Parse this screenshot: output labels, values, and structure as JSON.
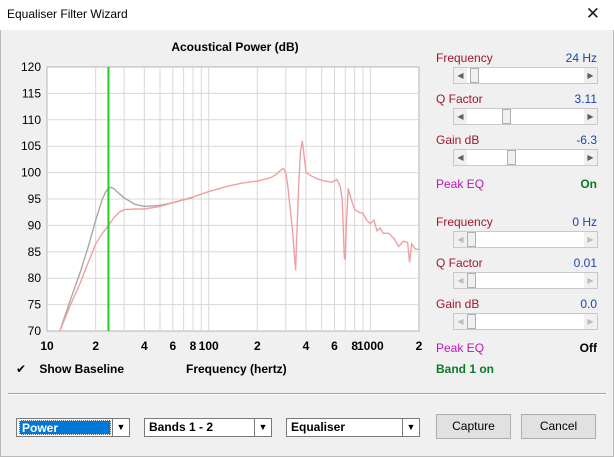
{
  "window": {
    "title": "Equaliser Filter Wizard",
    "close_glyph": "✕"
  },
  "chart_data": {
    "type": "line",
    "title": "Acoustical Power (dB)",
    "xlabel": "Frequency (hertz)",
    "ylabel": "",
    "xscale": "log",
    "xlim": [
      10,
      2000
    ],
    "ylim": [
      70,
      120
    ],
    "y_ticks": [
      70,
      75,
      80,
      85,
      90,
      95,
      100,
      105,
      110,
      115,
      120
    ],
    "x_tick_labels": [
      {
        "x": 10,
        "label": "10"
      },
      {
        "x": 20,
        "label": "2"
      },
      {
        "x": 40,
        "label": "4"
      },
      {
        "x": 60,
        "label": "6"
      },
      {
        "x": 80,
        "label": "8"
      },
      {
        "x": 100,
        "label": "100"
      },
      {
        "x": 200,
        "label": "2"
      },
      {
        "x": 400,
        "label": "4"
      },
      {
        "x": 600,
        "label": "6"
      },
      {
        "x": 800,
        "label": "8"
      },
      {
        "x": 1000,
        "label": "1000"
      },
      {
        "x": 2000,
        "label": "2"
      }
    ],
    "grid": true,
    "marker_line": {
      "x": 24,
      "color": "#22cc22"
    },
    "series": [
      {
        "role": "baseline",
        "color": "#a8a8a8",
        "points": [
          [
            12,
            70
          ],
          [
            14,
            76
          ],
          [
            16,
            81
          ],
          [
            18,
            86
          ],
          [
            20,
            91
          ],
          [
            22,
            95
          ],
          [
            23,
            96.3
          ],
          [
            24,
            97
          ],
          [
            25,
            97.2
          ],
          [
            26,
            96.9
          ],
          [
            28,
            96
          ],
          [
            30,
            95.2
          ],
          [
            35,
            94
          ],
          [
            40,
            93.6
          ],
          [
            50,
            93.8
          ],
          [
            60,
            94.3
          ],
          [
            80,
            95.3
          ]
        ]
      },
      {
        "role": "equalised",
        "color": "#f0a0a0",
        "points": [
          [
            12,
            70
          ],
          [
            14,
            75
          ],
          [
            16,
            79
          ],
          [
            18,
            83
          ],
          [
            20,
            86.5
          ],
          [
            22,
            88.5
          ],
          [
            24,
            90
          ],
          [
            26,
            91.5
          ],
          [
            28,
            92.5
          ],
          [
            30,
            93
          ],
          [
            35,
            93.1
          ],
          [
            40,
            93.1
          ],
          [
            50,
            93.6
          ],
          [
            60,
            94.3
          ],
          [
            70,
            94.9
          ],
          [
            80,
            95.4
          ],
          [
            100,
            96.4
          ],
          [
            130,
            97.4
          ],
          [
            160,
            98
          ],
          [
            200,
            98.4
          ],
          [
            240,
            99
          ],
          [
            260,
            99.6
          ],
          [
            280,
            100.5
          ],
          [
            290,
            100.8
          ],
          [
            300,
            100
          ],
          [
            310,
            97
          ],
          [
            320,
            93
          ],
          [
            330,
            89
          ],
          [
            340,
            84
          ],
          [
            345,
            81.5
          ],
          [
            350,
            87
          ],
          [
            360,
            97
          ],
          [
            370,
            104
          ],
          [
            380,
            106
          ],
          [
            390,
            103
          ],
          [
            400,
            100
          ],
          [
            430,
            99.4
          ],
          [
            470,
            98.8
          ],
          [
            520,
            98.4
          ],
          [
            580,
            98.2
          ],
          [
            620,
            98.7
          ],
          [
            650,
            97.5
          ],
          [
            670,
            95
          ],
          [
            690,
            84
          ],
          [
            700,
            83.5
          ],
          [
            710,
            90
          ],
          [
            730,
            97
          ],
          [
            760,
            95
          ],
          [
            800,
            93
          ],
          [
            850,
            92.5
          ],
          [
            900,
            92.3
          ],
          [
            950,
            91
          ],
          [
            1000,
            90.3
          ],
          [
            1050,
            91
          ],
          [
            1100,
            89
          ],
          [
            1150,
            89.5
          ],
          [
            1200,
            88.5
          ],
          [
            1300,
            88.5
          ],
          [
            1400,
            87.5
          ],
          [
            1500,
            86
          ],
          [
            1600,
            87
          ],
          [
            1700,
            86.8
          ],
          [
            1750,
            83
          ],
          [
            1800,
            86.5
          ],
          [
            1900,
            85.5
          ],
          [
            2000,
            85.5
          ]
        ]
      }
    ]
  },
  "band1": {
    "frequency_label": "Frequency",
    "frequency_value": "24 Hz",
    "frequency_pos": 0.03,
    "q_label": "Q Factor",
    "q_value": "3.11",
    "q_pos": 0.32,
    "gain_label": "Gain  dB",
    "gain_value": "-6.3",
    "gain_pos": 0.37,
    "type_label": "Peak EQ",
    "state": "On"
  },
  "band2": {
    "frequency_label": "Frequency",
    "frequency_value": "0 Hz",
    "frequency_pos": 0.0,
    "q_label": "Q Factor",
    "q_value": "0.01",
    "q_pos": 0.0,
    "gain_label": "Gain  dB",
    "gain_value": "0.0",
    "gain_pos": 0.0,
    "type_label": "Peak EQ",
    "state": "Off"
  },
  "baseline_checkbox": {
    "checked": true,
    "check_glyph": "✔",
    "label": "Show Baseline"
  },
  "band_status": "Band 1 on",
  "controls": {
    "view_select": "Power",
    "bands_select": "Bands 1 - 2",
    "mode_select": "Equaliser",
    "capture_label": "Capture",
    "cancel_label": "Cancel",
    "dropdown_glyph": "▼"
  },
  "colors": {
    "label_red": "#a3162a",
    "value_blue": "#1a44b0",
    "peak_magenta": "#c211c2",
    "on_green": "#0b7a26",
    "selection": "#0078d7"
  }
}
